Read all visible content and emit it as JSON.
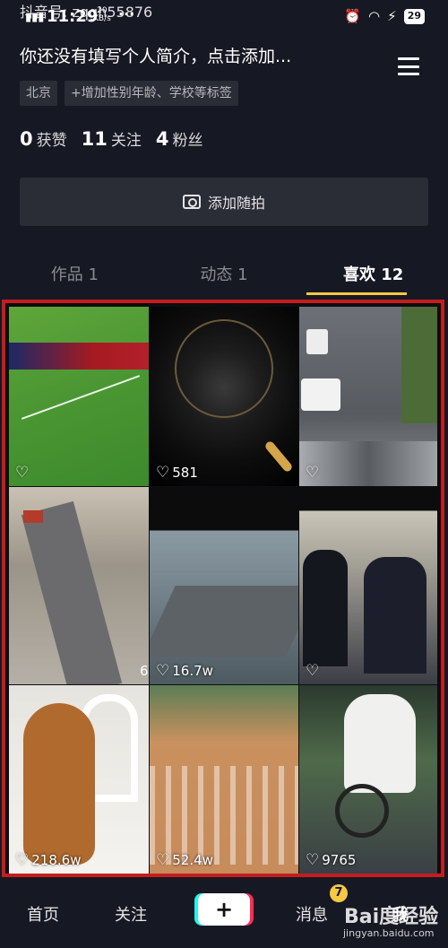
{
  "status_bar": {
    "douyin_id": "抖音号: zqgh55876",
    "signal": "4G",
    "time": "11:29",
    "speed_value": "20",
    "speed_unit": "KB/s",
    "dots": "···",
    "battery": "29"
  },
  "profile": {
    "bio": "你还没有填写个人简介，点击添加...",
    "tags": [
      "北京",
      "+增加性别年龄、学校等标签"
    ],
    "stats": [
      {
        "num": "0",
        "label": "获赞"
      },
      {
        "num": "11",
        "label": "关注"
      },
      {
        "num": "4",
        "label": "粉丝"
      }
    ],
    "add_moment_label": "添加随拍"
  },
  "tabs": [
    {
      "label": "作品 1",
      "active": false
    },
    {
      "label": "动态 1",
      "active": false
    },
    {
      "label": "喜欢 12",
      "active": true
    }
  ],
  "grid": {
    "items": [
      {
        "likes": ""
      },
      {
        "likes": "581"
      },
      {
        "likes": ""
      },
      {
        "likes": ""
      },
      {
        "likes": "16.7w"
      },
      {
        "likes": ""
      },
      {
        "likes": "218.6w"
      },
      {
        "likes": "52.4w"
      },
      {
        "likes": "9765"
      }
    ],
    "item5_prefix": "6",
    "frame_color": "#c51d1d"
  },
  "bottom_nav": {
    "home": "首页",
    "follow": "关注",
    "plus": "+",
    "messages": "消息",
    "messages_badge": "7",
    "me": "我"
  },
  "watermark": {
    "brand": "Bai度经验",
    "url": "jingyan.baidu.com"
  }
}
